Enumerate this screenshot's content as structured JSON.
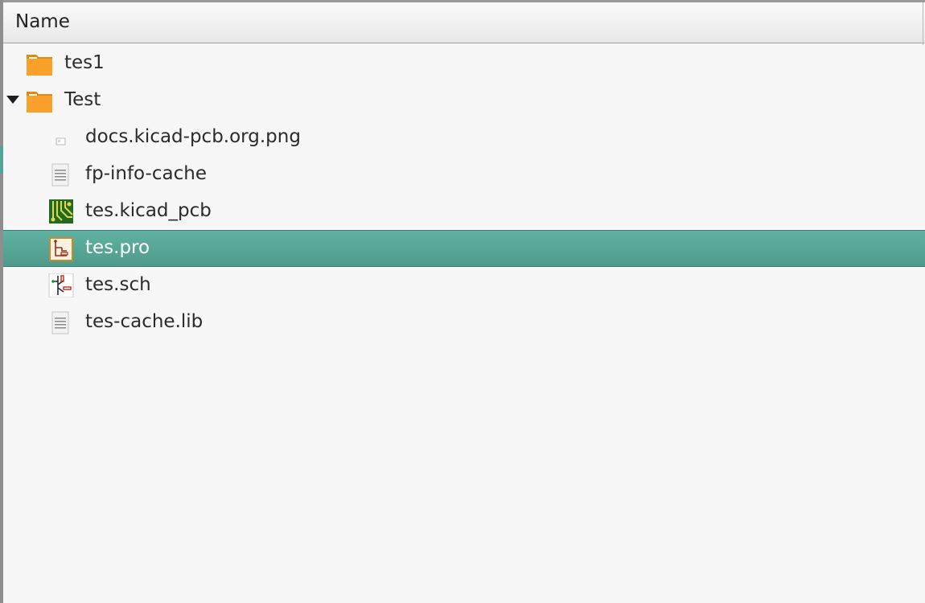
{
  "header": {
    "column_name": "Name"
  },
  "tree": {
    "items": [
      {
        "label": "tes1",
        "icon": "folder-icon",
        "depth": 0,
        "expanded": false,
        "selected": false
      },
      {
        "label": "Test",
        "icon": "folder-icon",
        "depth": 0,
        "expanded": true,
        "selected": false
      },
      {
        "label": "docs.kicad-pcb.org.png",
        "icon": "image-file-icon",
        "depth": 1,
        "selected": false
      },
      {
        "label": "fp-info-cache",
        "icon": "text-file-icon",
        "depth": 1,
        "selected": false
      },
      {
        "label": "tes.kicad_pcb",
        "icon": "kicad-pcb-icon",
        "depth": 1,
        "selected": false
      },
      {
        "label": "tes.pro",
        "icon": "kicad-project-icon",
        "depth": 1,
        "selected": true
      },
      {
        "label": "tes.sch",
        "icon": "kicad-schematic-icon",
        "depth": 1,
        "selected": false
      },
      {
        "label": "tes-cache.lib",
        "icon": "text-file-icon",
        "depth": 1,
        "selected": false
      }
    ]
  },
  "colors": {
    "selection": "#52a594",
    "folder": "#f9a12b",
    "pcb_green": "#1f6b1f"
  }
}
